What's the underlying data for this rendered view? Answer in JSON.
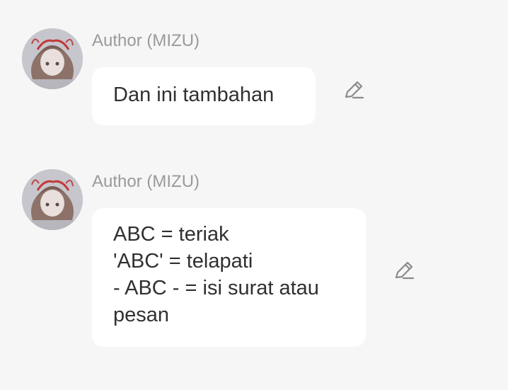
{
  "messages": [
    {
      "author": "Author (MIZU)",
      "text": "Dan ini tambahan"
    },
    {
      "author": "Author (MIZU)",
      "text": "ABC = teriak\n'ABC' = telapati\n- ABC - = isi surat atau\npesan"
    }
  ],
  "icons": {
    "edit": "pencil-icon",
    "avatar": "anime-girl-avatar"
  },
  "colors": {
    "background": "#f6f6f6",
    "bubble": "#ffffff",
    "author": "#9a9a9a",
    "text": "#303030",
    "icon": "#8a8a8a"
  }
}
